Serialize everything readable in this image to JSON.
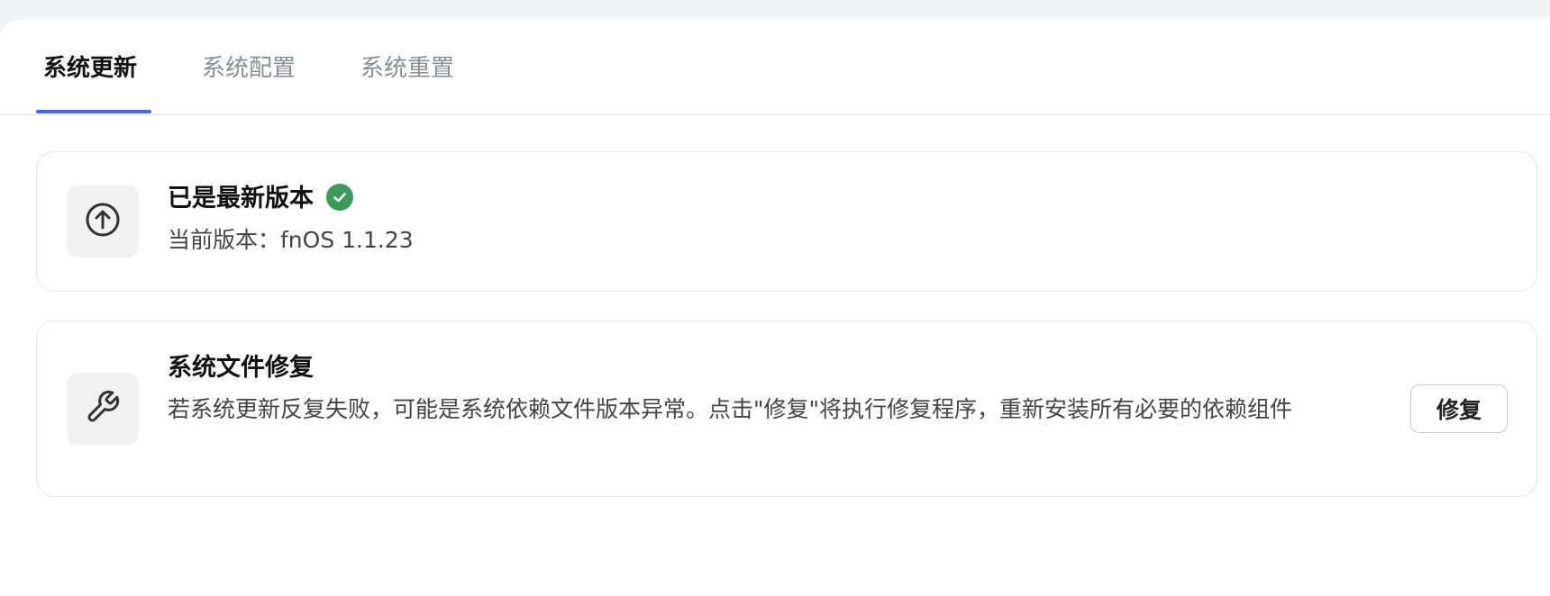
{
  "tabs": [
    {
      "label": "系统更新",
      "active": true
    },
    {
      "label": "系统配置",
      "active": false
    },
    {
      "label": "系统重置",
      "active": false
    }
  ],
  "accent_color": "#4a63e8",
  "update_card": {
    "icon": "arrow-up-circle-icon",
    "title": "已是最新版本",
    "status_icon": "check-circle-icon",
    "status_color": "#3e9a5a",
    "version_text": "当前版本：fnOS 1.1.23"
  },
  "repair_card": {
    "icon": "wrench-icon",
    "title": "系统文件修复",
    "description": "若系统更新反复失败，可能是系统依赖文件版本异常。点击\"修复\"将执行修复程序，重新安装所有必要的依赖组件",
    "button_label": "修复"
  }
}
